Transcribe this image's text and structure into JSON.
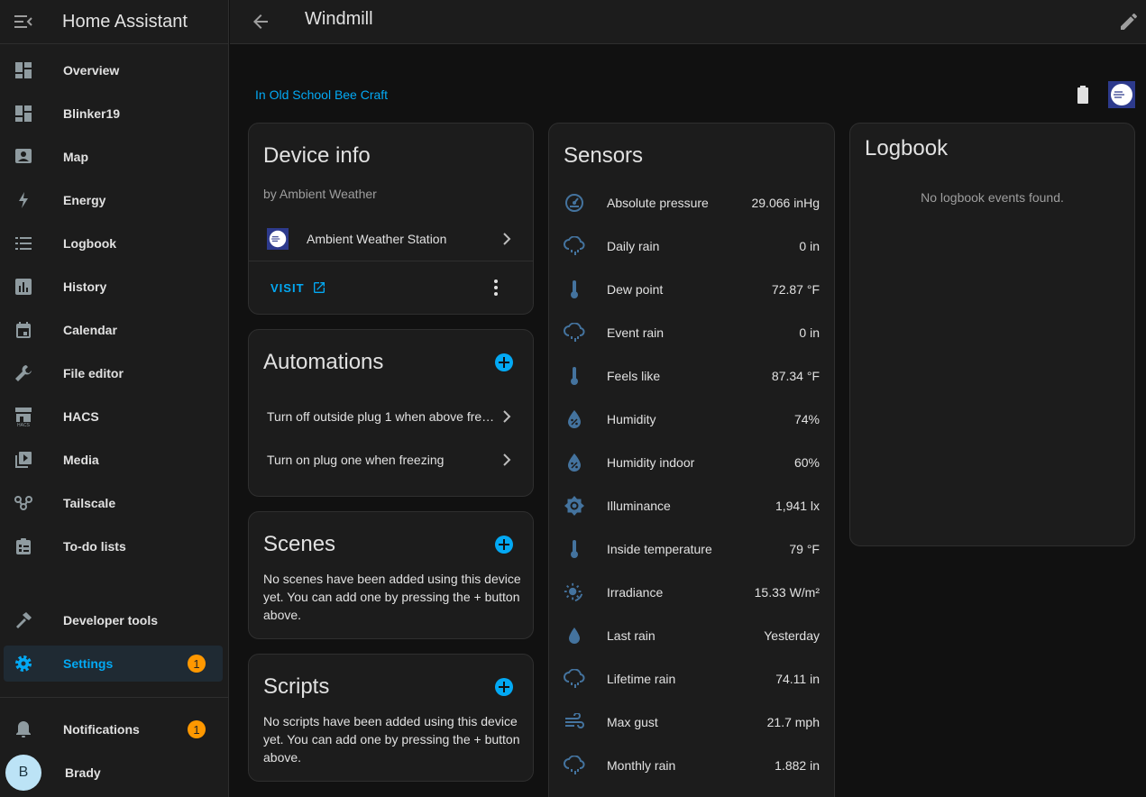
{
  "app": {
    "title": "Home Assistant"
  },
  "sidebar": {
    "items": [
      {
        "label": "Overview",
        "icon": "dashboard-icon"
      },
      {
        "label": "Blinker19",
        "icon": "dashboard-icon"
      },
      {
        "label": "Map",
        "icon": "map-icon"
      },
      {
        "label": "Energy",
        "icon": "lightning-icon"
      },
      {
        "label": "Logbook",
        "icon": "list-icon"
      },
      {
        "label": "History",
        "icon": "chart-icon"
      },
      {
        "label": "Calendar",
        "icon": "calendar-icon"
      },
      {
        "label": "File editor",
        "icon": "wrench-icon"
      },
      {
        "label": "HACS",
        "icon": "hacs-icon"
      },
      {
        "label": "Media",
        "icon": "media-icon"
      },
      {
        "label": "Tailscale",
        "icon": "tailscale-icon"
      },
      {
        "label": "To-do lists",
        "icon": "clipboard-icon"
      }
    ],
    "developer_tools": "Developer tools",
    "settings": {
      "label": "Settings",
      "badge": "1"
    },
    "notifications": {
      "label": "Notifications",
      "badge": "1"
    },
    "user": {
      "name": "Brady",
      "initial": "B"
    }
  },
  "page": {
    "title": "Windmill",
    "area": "In Old School Bee Craft"
  },
  "device_info": {
    "title": "Device info",
    "manufacturer": "by Ambient Weather",
    "device": "Ambient Weather Station",
    "visit": "VISIT"
  },
  "automations": {
    "title": "Automations",
    "items": [
      "Turn off outside plug 1 when above fre…",
      "Turn on plug one when freezing"
    ]
  },
  "scenes": {
    "title": "Scenes",
    "empty": "No scenes have been added using this device yet. You can add one by pressing the + button above."
  },
  "scripts": {
    "title": "Scripts",
    "empty": "No scripts have been added using this device yet. You can add one by pressing the + button above."
  },
  "sensors": {
    "title": "Sensors",
    "items": [
      {
        "name": "Absolute pressure",
        "value": "29.066 inHg",
        "icon": "gauge-icon"
      },
      {
        "name": "Daily rain",
        "value": "0 in",
        "icon": "rain-icon"
      },
      {
        "name": "Dew point",
        "value": "72.87 °F",
        "icon": "thermometer-icon"
      },
      {
        "name": "Event rain",
        "value": "0 in",
        "icon": "rain-icon"
      },
      {
        "name": "Feels like",
        "value": "87.34 °F",
        "icon": "thermometer-icon"
      },
      {
        "name": "Humidity",
        "value": "74%",
        "icon": "humidity-icon"
      },
      {
        "name": "Humidity indoor",
        "value": "60%",
        "icon": "humidity-icon"
      },
      {
        "name": "Illuminance",
        "value": "1,941 lx",
        "icon": "brightness-icon"
      },
      {
        "name": "Inside temperature",
        "value": "79 °F",
        "icon": "thermometer-icon"
      },
      {
        "name": "Irradiance",
        "value": "15.33 W/m²",
        "icon": "sun-icon"
      },
      {
        "name": "Last rain",
        "value": "Yesterday",
        "icon": "drop-icon"
      },
      {
        "name": "Lifetime rain",
        "value": "74.11 in",
        "icon": "rain-icon"
      },
      {
        "name": "Max gust",
        "value": "21.7 mph",
        "icon": "wind-icon"
      },
      {
        "name": "Monthly rain",
        "value": "1.882 in",
        "icon": "rain-icon"
      }
    ]
  },
  "logbook": {
    "title": "Logbook",
    "empty": "No logbook events found."
  },
  "colors": {
    "accent": "#03a9f4",
    "badge": "#ff9800",
    "icon": "#8fa3ae",
    "sensor_icon": "#44739e"
  }
}
